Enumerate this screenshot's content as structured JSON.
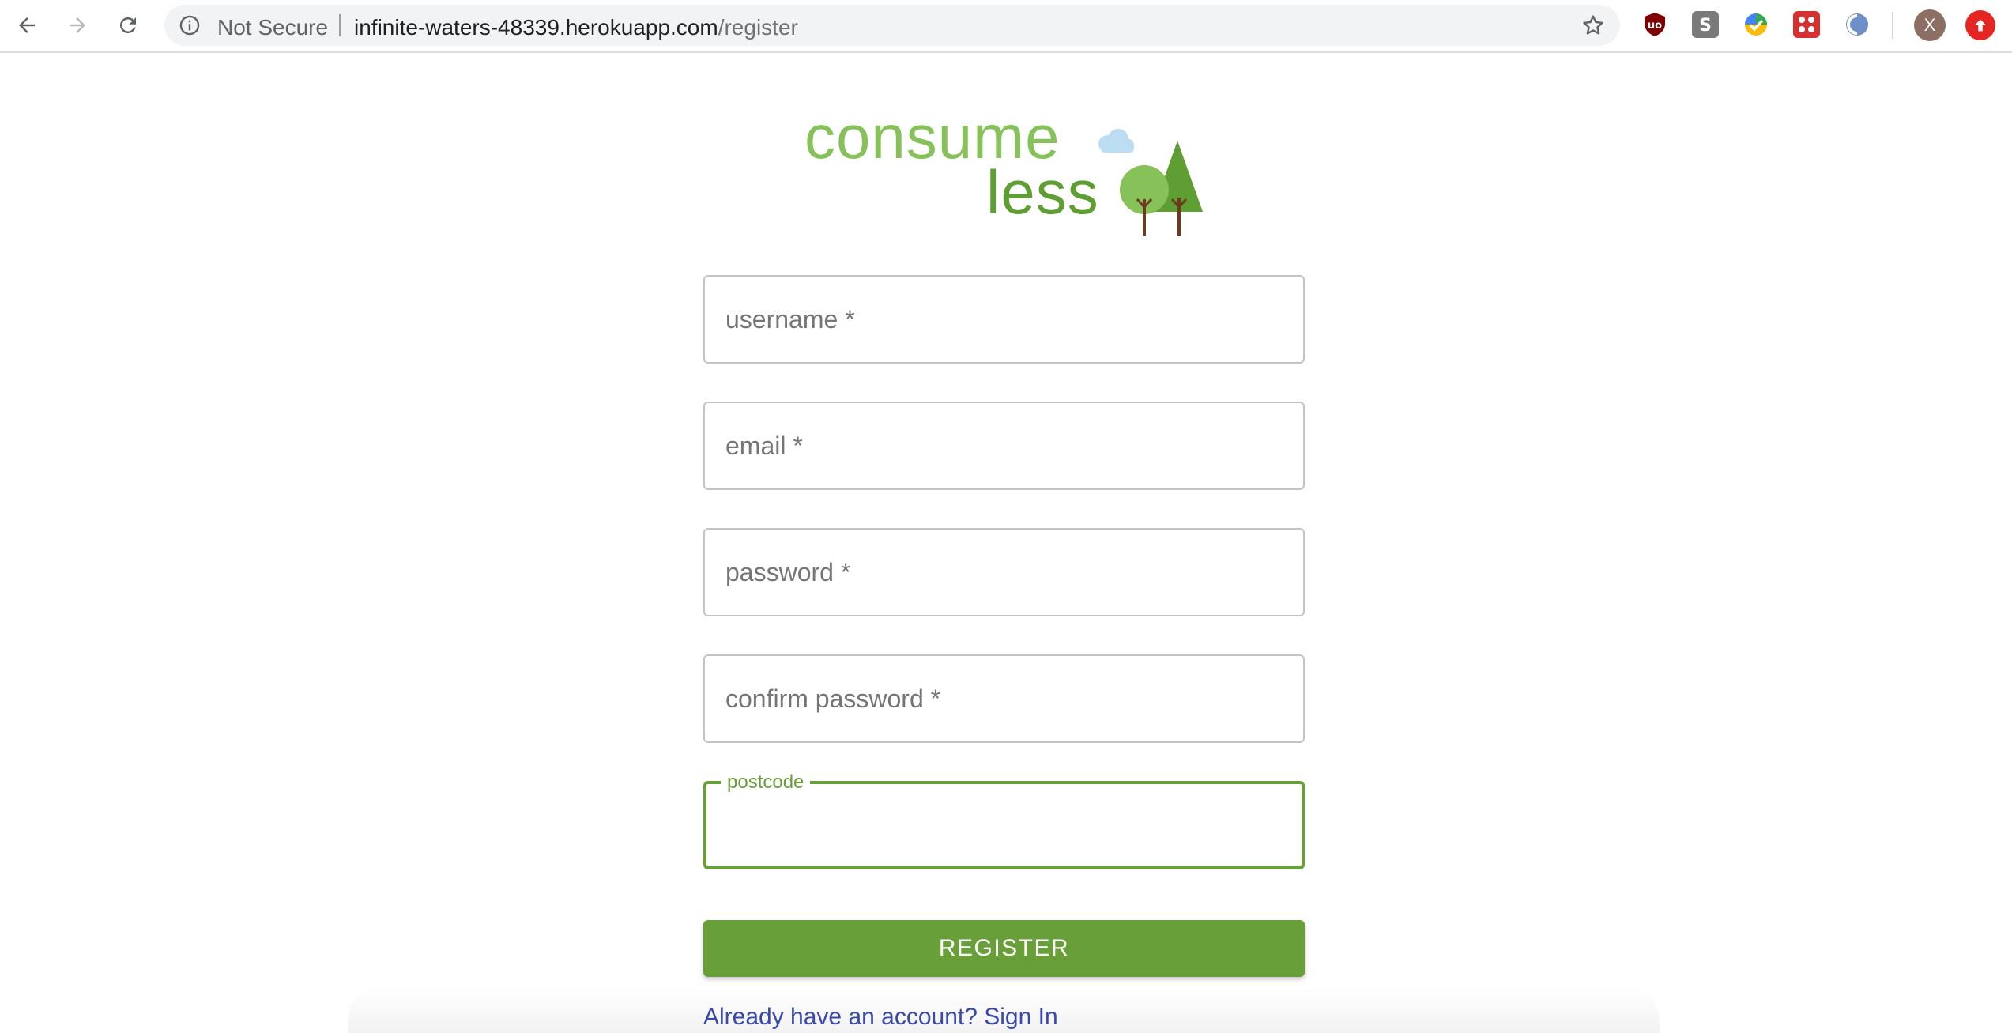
{
  "browser": {
    "security_label": "Not Secure",
    "url_host": "infinite-waters-48339.herokuapp.com",
    "url_path": "/register",
    "avatar_initial": "X",
    "extensions": [
      "ublock-origin-extension",
      "scribe-extension",
      "color-picker-extension",
      "screen-recorder-extension",
      "sync-extension"
    ]
  },
  "logo": {
    "line1": "consume",
    "line2": "less"
  },
  "form": {
    "fields": [
      {
        "placeholder": "username *"
      },
      {
        "placeholder": "email *"
      },
      {
        "placeholder": "password *"
      },
      {
        "placeholder": "confirm password *"
      },
      {
        "label": "postcode",
        "value": ""
      }
    ],
    "submit_label": "REGISTER",
    "signin_link": "Already have an account? Sign In"
  },
  "colors": {
    "primary": "#689f38",
    "logo_light": "#86c15a",
    "logo_dark": "#5f9e33",
    "link": "#3949ab",
    "tree_trunk": "#6d3b1f"
  }
}
